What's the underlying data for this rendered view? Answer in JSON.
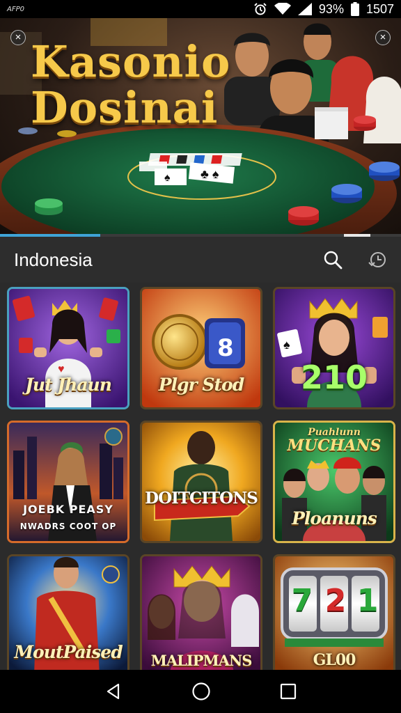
{
  "status_bar": {
    "app_label": "AFP0",
    "battery": "93%",
    "time": "1507",
    "icons": [
      "alarm-icon",
      "wifi-icon",
      "signal-icon",
      "battery-icon"
    ]
  },
  "banner": {
    "title_line1": "Kasonio",
    "title_line2": "Dosinai",
    "close_glyph": "×",
    "slides": {
      "current": 1,
      "progress": 0.25
    }
  },
  "header": {
    "region": "Indonesia",
    "icons": [
      "search-icon",
      "history-icon"
    ]
  },
  "games": [
    {
      "label": "Jut Jhaun",
      "theme": "purple"
    },
    {
      "label": "Plgr Stod",
      "theme": "orange"
    },
    {
      "label": "210",
      "theme": "purple"
    },
    {
      "label": "JOEBK PEASY",
      "sub": "NWADRS COOT OP",
      "theme": "city"
    },
    {
      "label": "DOITCITONS",
      "theme": "gold"
    },
    {
      "label": "Ploanuns",
      "title_top": "Puahlunn",
      "title_mid": "MUCHANS",
      "theme": "green"
    },
    {
      "label": "MoutPaised",
      "theme": "blue"
    },
    {
      "label": "MALIPMANS",
      "theme": "magenta"
    },
    {
      "label": "GL00",
      "reels": [
        "7",
        "2",
        "1"
      ],
      "theme": "slot"
    }
  ],
  "colors": {
    "accent": "#3fa3d6",
    "gold": "#f6c94a",
    "background": "#2b2b2b"
  },
  "nav": {
    "icons": [
      "back-icon",
      "home-icon",
      "recents-icon"
    ]
  }
}
